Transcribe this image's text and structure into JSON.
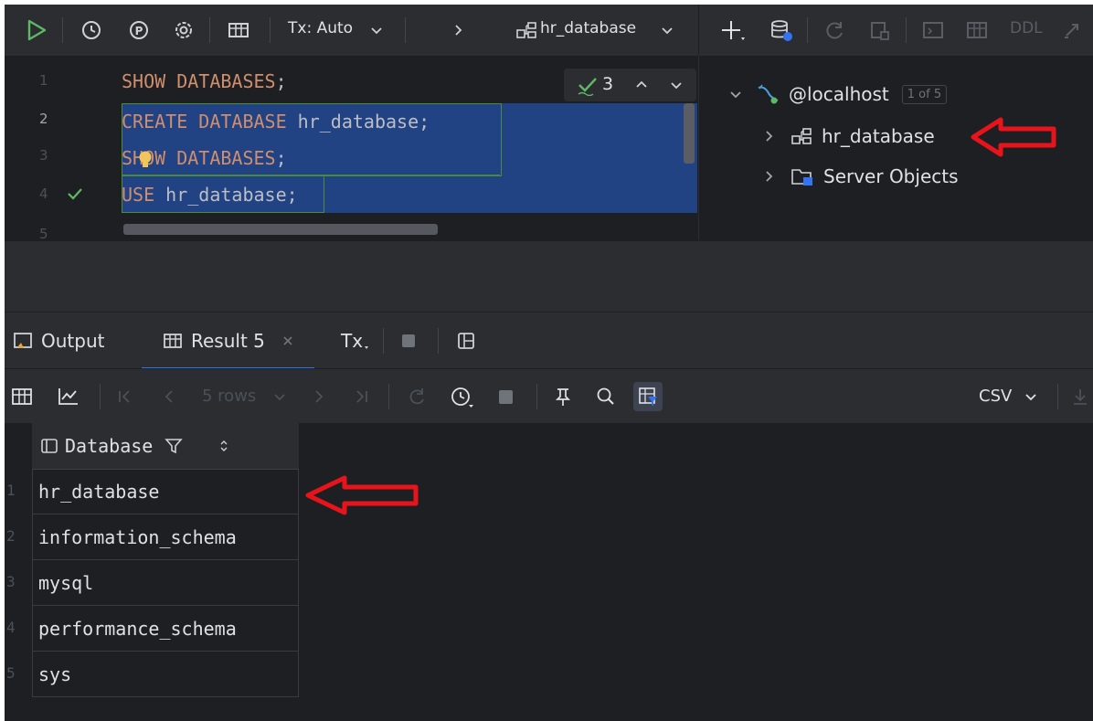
{
  "toolbar": {
    "tx_mode": "Tx: Auto",
    "database": "hr_database",
    "ddl_label": "DDL"
  },
  "editor": {
    "lines": [
      {
        "num": "1",
        "kw1": "SHOW",
        "kw2": "DATABASES",
        "rest": ";"
      },
      {
        "num": "2",
        "kw1": "CREATE",
        "kw2": "DATABASE",
        "ident": "hr_database",
        "rest": ";"
      },
      {
        "num": "3",
        "kw1": "SHOW",
        "kw2": "DATABASES",
        "rest": ";"
      },
      {
        "num": "4",
        "kw1": "USE",
        "ident": "hr_database",
        "rest": ";"
      },
      {
        "num": "5"
      }
    ],
    "inspection_count": "3"
  },
  "tree": {
    "host": "@localhost",
    "host_badge": "1 of 5",
    "items": [
      {
        "label": "hr_database",
        "icon": "schema-icon"
      },
      {
        "label": "Server Objects",
        "icon": "folder-icon"
      }
    ]
  },
  "panel": {
    "tabs": [
      {
        "label": "Output",
        "icon": "console-icon"
      },
      {
        "label": "Result 5",
        "icon": "table-icon",
        "active": true
      },
      {
        "label": "Tx",
        "icon": "transaction-icon"
      }
    ],
    "rows_label": "5 rows",
    "export_format": "CSV"
  },
  "grid": {
    "column": "Database",
    "rows": [
      {
        "num": "1",
        "value": "hr_database"
      },
      {
        "num": "2",
        "value": "information_schema"
      },
      {
        "num": "3",
        "value": "mysql"
      },
      {
        "num": "4",
        "value": "performance_schema"
      },
      {
        "num": "5",
        "value": "sys"
      }
    ]
  },
  "colors": {
    "keyword": "#cf8e6d",
    "selection": "#214283",
    "annotation_arrow": "#e8141c",
    "run_green": "#5fb865"
  }
}
